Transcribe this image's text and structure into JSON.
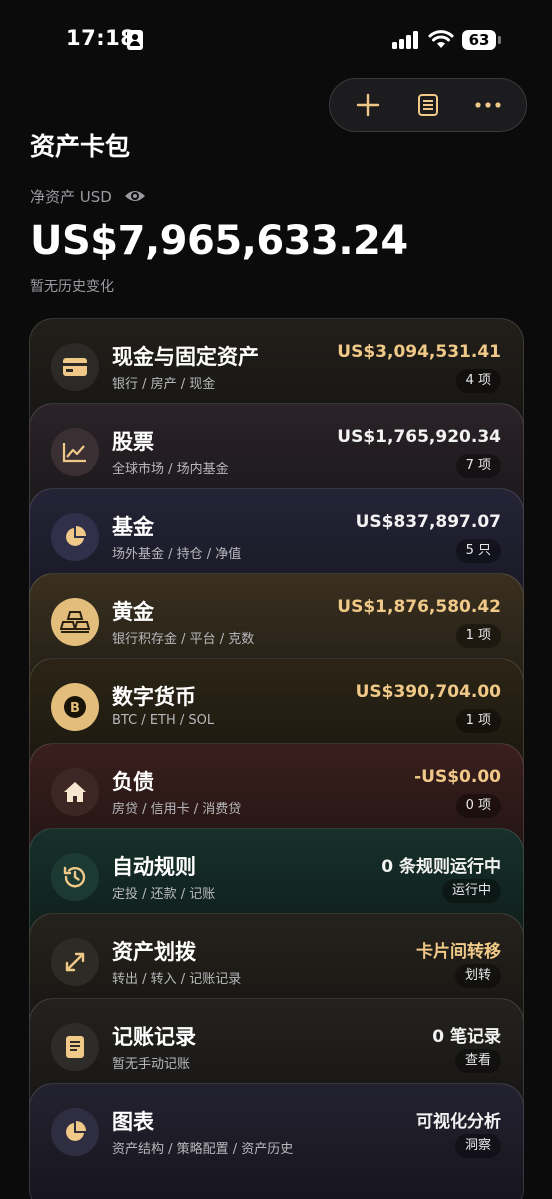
{
  "status_bar": {
    "time": "17:18",
    "battery": "63"
  },
  "toolbar": {
    "add_icon": "plus-icon",
    "list_icon": "list-icon",
    "more_icon": "more-icon"
  },
  "header": {
    "title": "资产卡包",
    "net_worth_label": "净资产 USD",
    "net_worth_value": "US$7,965,633.24",
    "history_text": "暂无历史变化"
  },
  "cards": [
    {
      "title": "现金与固定资产",
      "subtitle": "银行 / 房产 / 现金",
      "amount": "US$3,094,531.41",
      "badge": "4 项",
      "icon": "card-icon",
      "amount_color": "#f0c988"
    },
    {
      "title": "股票",
      "subtitle": "全球市场 / 场内基金",
      "amount": "US$1,765,920.34",
      "badge": "7 项",
      "icon": "chart-icon",
      "amount_color": "#f2f2f2"
    },
    {
      "title": "基金",
      "subtitle": "场外基金 / 持仓 / 净值",
      "amount": "US$837,897.07",
      "badge": "5 只",
      "icon": "pie-icon",
      "amount_color": "#f2f2f2"
    },
    {
      "title": "黄金",
      "subtitle": "银行积存金 / 平台 / 克数",
      "amount": "US$1,876,580.42",
      "badge": "1 项",
      "icon": "gold-bars-icon",
      "amount_color": "#f0c988"
    },
    {
      "title": "数字货币",
      "subtitle": "BTC / ETH / SOL",
      "amount": "US$390,704.00",
      "badge": "1 项",
      "icon": "bitcoin-icon",
      "amount_color": "#f0c988"
    },
    {
      "title": "负债",
      "subtitle": "房贷 / 信用卡 / 消费贷",
      "amount": "-US$0.00",
      "badge": "0 项",
      "icon": "home-icon",
      "amount_color": "#f0c988"
    },
    {
      "title": "自动规则",
      "subtitle": "定投 / 还款 / 记账",
      "amount": "0 条规则运行中",
      "badge": "运行中",
      "icon": "history-icon",
      "amount_color": "#f2f2f2"
    },
    {
      "title": "资产划拨",
      "subtitle": "转出 / 转入 / 记账记录",
      "amount": "卡片间转移",
      "badge": "划转",
      "icon": "transfer-icon",
      "amount_color": "#f0c988"
    },
    {
      "title": "记账记录",
      "subtitle": "暂无手动记账",
      "amount": "0 笔记录",
      "badge": "查看",
      "icon": "ledger-icon",
      "amount_color": "#f2f2f2"
    },
    {
      "title": "图表",
      "subtitle": "资产结构 / 策略配置 / 资产历史",
      "amount": "可视化分析",
      "badge": "洞察",
      "icon": "pie-icon",
      "amount_color": "#f2f2f2"
    }
  ]
}
